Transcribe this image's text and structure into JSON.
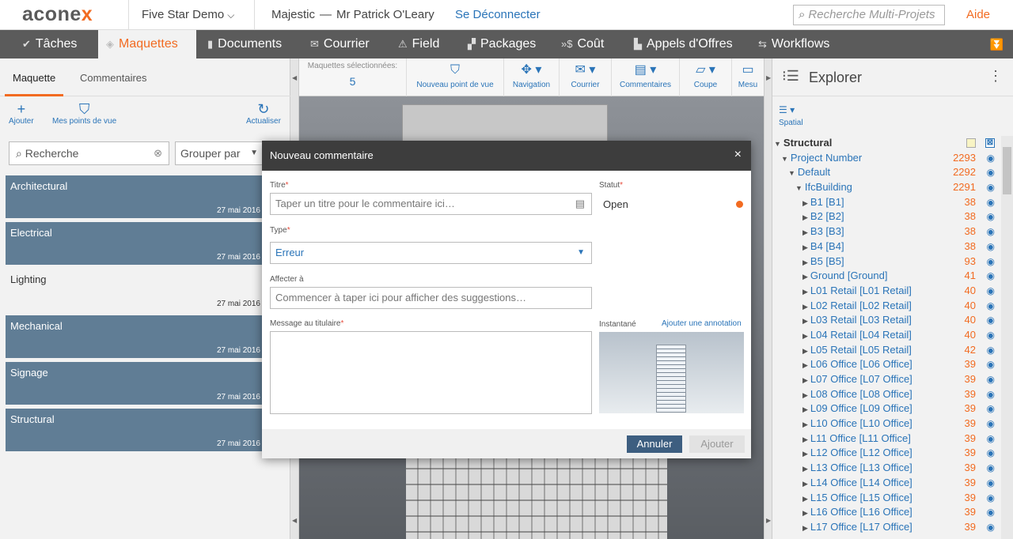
{
  "header": {
    "logo_prefix": "acone",
    "logo_suffix": "x",
    "project": "Five Star Demo",
    "project_chevron": "chevron-down-icon",
    "org": "Majestic",
    "separator": "—",
    "user": "Mr Patrick O'Leary",
    "logout": "Se Déconnecter",
    "search_placeholder": "Recherche Multi-Projets",
    "help": "Aide"
  },
  "nav": {
    "items": [
      {
        "label": "Tâches",
        "icon": "check-icon",
        "active": false
      },
      {
        "label": "Maquettes",
        "icon": "cube-icon",
        "active": true
      },
      {
        "label": "Documents",
        "icon": "document-icon",
        "active": false
      },
      {
        "label": "Courrier",
        "icon": "mail-icon",
        "active": false
      },
      {
        "label": "Field",
        "icon": "warning-icon",
        "active": false
      },
      {
        "label": "Packages",
        "icon": "packages-icon",
        "active": false
      },
      {
        "label": "Coût",
        "icon": "cost-icon",
        "active": false
      },
      {
        "label": "Appels d'Offres",
        "icon": "tender-icon",
        "active": false
      },
      {
        "label": "Workflows",
        "icon": "workflow-icon",
        "active": false
      }
    ],
    "more_icon": "chevron-double-down-icon"
  },
  "left": {
    "tabs": [
      "Maquette",
      "Commentaires"
    ],
    "actions": {
      "add": "Ajouter",
      "views": "Mes points de vue",
      "refresh": "Actualiser"
    },
    "search_placeholder": "Recherche",
    "group_by": "Grouper par",
    "models": [
      {
        "name": "Architectural",
        "date": "27 mai 2016",
        "selected": true
      },
      {
        "name": "Electrical",
        "date": "27 mai 2016",
        "selected": true
      },
      {
        "name": "Lighting",
        "date": "27 mai 2016",
        "selected": false
      },
      {
        "name": "Mechanical",
        "date": "27 mai 2016",
        "selected": true
      },
      {
        "name": "Signage",
        "date": "27 mai 2016",
        "selected": true
      },
      {
        "name": "Structural",
        "date": "27 mai 2016",
        "selected": true
      }
    ]
  },
  "viewer": {
    "selected_label": "Maquettes sélectionnées:",
    "selected_count": "5",
    "tools": [
      {
        "label": "Nouveau point de vue",
        "icon": "bookmark-icon"
      },
      {
        "label": "Navigation",
        "icon": "navigation-icon"
      },
      {
        "label": "Courrier",
        "icon": "mail-icon"
      },
      {
        "label": "Commentaires",
        "icon": "comment-icon"
      },
      {
        "label": "Coupe",
        "icon": "section-cut-icon"
      },
      {
        "label": "Mesu",
        "icon": "measure-icon"
      }
    ]
  },
  "explorer": {
    "title": "Explorer",
    "spatial": "Spatial",
    "tree": [
      {
        "label": "Structural",
        "level": 0,
        "count": "",
        "root": true
      },
      {
        "label": "Project Number",
        "level": 1,
        "count": "2293"
      },
      {
        "label": "Default",
        "level": 2,
        "count": "2292"
      },
      {
        "label": "IfcBuilding",
        "level": 3,
        "count": "2291"
      },
      {
        "label": "B1 [B1]",
        "level": 4,
        "count": "38"
      },
      {
        "label": "B2 [B2]",
        "level": 4,
        "count": "38"
      },
      {
        "label": "B3 [B3]",
        "level": 4,
        "count": "38"
      },
      {
        "label": "B4 [B4]",
        "level": 4,
        "count": "38"
      },
      {
        "label": "B5 [B5]",
        "level": 4,
        "count": "93"
      },
      {
        "label": "Ground [Ground]",
        "level": 4,
        "count": "41"
      },
      {
        "label": "L01 Retail [L01 Retail]",
        "level": 4,
        "count": "40"
      },
      {
        "label": "L02 Retail [L02 Retail]",
        "level": 4,
        "count": "40"
      },
      {
        "label": "L03 Retail [L03 Retail]",
        "level": 4,
        "count": "40"
      },
      {
        "label": "L04 Retail [L04 Retail]",
        "level": 4,
        "count": "40"
      },
      {
        "label": "L05 Retail [L05 Retail]",
        "level": 4,
        "count": "42"
      },
      {
        "label": "L06 Office [L06 Office]",
        "level": 4,
        "count": "39"
      },
      {
        "label": "L07 Office [L07 Office]",
        "level": 4,
        "count": "39"
      },
      {
        "label": "L08 Office [L08 Office]",
        "level": 4,
        "count": "39"
      },
      {
        "label": "L09 Office [L09 Office]",
        "level": 4,
        "count": "39"
      },
      {
        "label": "L10 Office [L10 Office]",
        "level": 4,
        "count": "39"
      },
      {
        "label": "L11 Office [L11 Office]",
        "level": 4,
        "count": "39"
      },
      {
        "label": "L12 Office [L12 Office]",
        "level": 4,
        "count": "39"
      },
      {
        "label": "L13 Office [L13 Office]",
        "level": 4,
        "count": "39"
      },
      {
        "label": "L14 Office [L14 Office]",
        "level": 4,
        "count": "39"
      },
      {
        "label": "L15 Office [L15 Office]",
        "level": 4,
        "count": "39"
      },
      {
        "label": "L16 Office [L16 Office]",
        "level": 4,
        "count": "39"
      },
      {
        "label": "L17 Office [L17 Office]",
        "level": 4,
        "count": "39"
      }
    ]
  },
  "modal": {
    "title": "Nouveau commentaire",
    "title_label": "Titre",
    "title_placeholder": "Taper un titre pour le commentaire ici…",
    "type_label": "Type",
    "type_value": "Erreur",
    "assign_label": "Affecter à",
    "assign_placeholder": "Commencer à taper ici pour afficher des suggestions…",
    "message_label": "Message au titulaire",
    "status_label": "Statut",
    "status_value": "Open",
    "status_color": "#f26b21",
    "snapshot_label": "Instantané",
    "annotation_link": "Ajouter une annotation",
    "cancel": "Annuler",
    "add": "Ajouter",
    "required_mark": "*"
  },
  "colors": {
    "accent": "#f26b21",
    "link": "#2a74b8",
    "nav_bg": "#5b5b5b",
    "model_selected": "#607d95"
  }
}
